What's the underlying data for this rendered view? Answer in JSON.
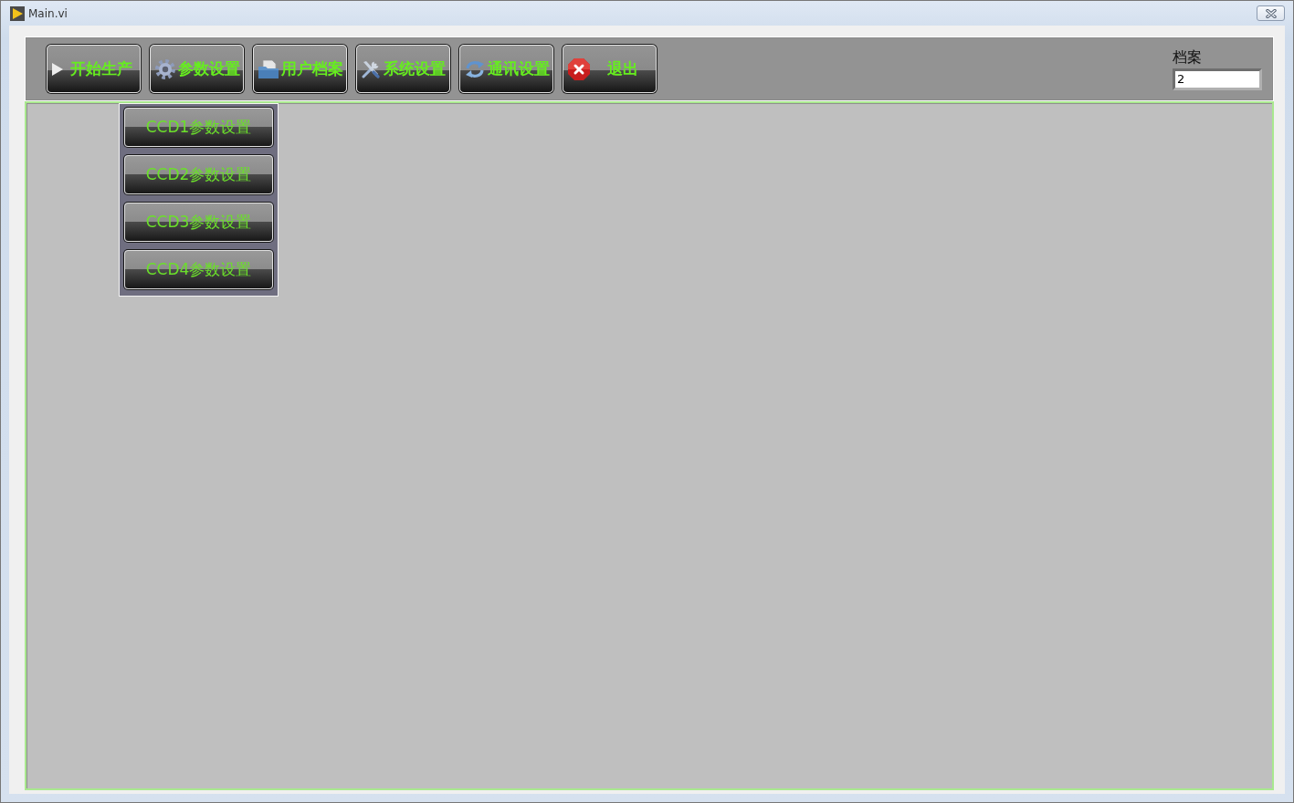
{
  "window": {
    "title": "Main.vi"
  },
  "toolbar": {
    "buttons": [
      {
        "label": "开始生产",
        "kind": "start"
      },
      {
        "label": "参数设置",
        "kind": "settings",
        "submenu": [
          {
            "label": "CCD1参数设置"
          },
          {
            "label": "CCD2参数设置"
          },
          {
            "label": "CCD3参数设置"
          },
          {
            "label": "CCD4参数设置"
          }
        ]
      },
      {
        "label": "用户档案",
        "kind": "files"
      },
      {
        "label": "系统设置",
        "kind": "tools"
      },
      {
        "label": "通讯设置",
        "kind": "sync"
      },
      {
        "label": "退出",
        "kind": "exit"
      }
    ]
  },
  "profile_field": {
    "label": "档案",
    "value": "2"
  }
}
